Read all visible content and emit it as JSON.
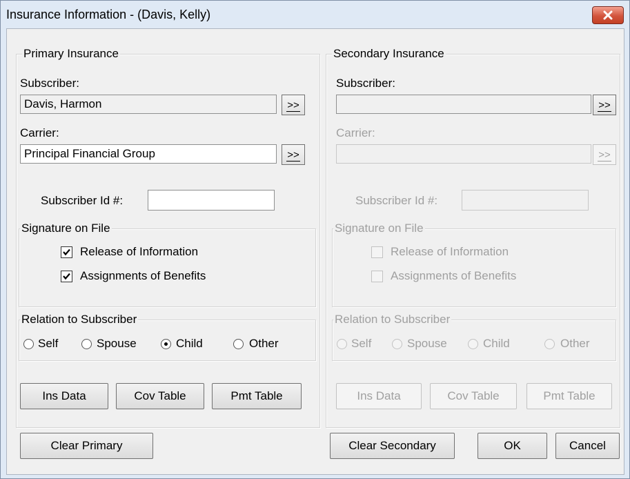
{
  "window": {
    "title": "Insurance Information - (Davis, Kelly)"
  },
  "primary": {
    "group_title": "Primary Insurance",
    "subscriber_label": "Subscriber:",
    "subscriber_value": "Davis, Harmon",
    "carrier_label": "Carrier:",
    "carrier_value": "Principal Financial Group",
    "subscriber_id_label": "Subscriber Id #:",
    "subscriber_id_value": "",
    "browse_label": ">>",
    "signature_title": "Signature on File",
    "release_label": "Release of Information",
    "release_checked": true,
    "assign_label": "Assignments of Benefits",
    "assign_checked": true,
    "relation_title": "Relation to Subscriber",
    "relation_options": [
      "Self",
      "Spouse",
      "Child",
      "Other"
    ],
    "relation_selected": "Child",
    "ins_data_label": "Ins Data",
    "cov_table_label": "Cov Table",
    "pmt_table_label": "Pmt Table"
  },
  "secondary": {
    "group_title": "Secondary Insurance",
    "subscriber_label": "Subscriber:",
    "subscriber_value": "",
    "carrier_label": "Carrier:",
    "carrier_value": "",
    "subscriber_id_label": "Subscriber Id #:",
    "subscriber_id_value": "",
    "browse_label": ">>",
    "signature_title": "Signature on File",
    "release_label": "Release of Information",
    "release_checked": false,
    "assign_label": "Assignments of Benefits",
    "assign_checked": false,
    "relation_title": "Relation to Subscriber",
    "relation_options": [
      "Self",
      "Spouse",
      "Child",
      "Other"
    ],
    "relation_selected": "",
    "ins_data_label": "Ins Data",
    "cov_table_label": "Cov Table",
    "pmt_table_label": "Pmt Table"
  },
  "footer": {
    "clear_primary_label": "Clear Primary",
    "clear_secondary_label": "Clear Secondary",
    "ok_label": "OK",
    "cancel_label": "Cancel"
  },
  "colors": {
    "title_bg": "#dfe9f5",
    "close_red": "#c34025",
    "disabled_text": "#a0a0a0"
  }
}
